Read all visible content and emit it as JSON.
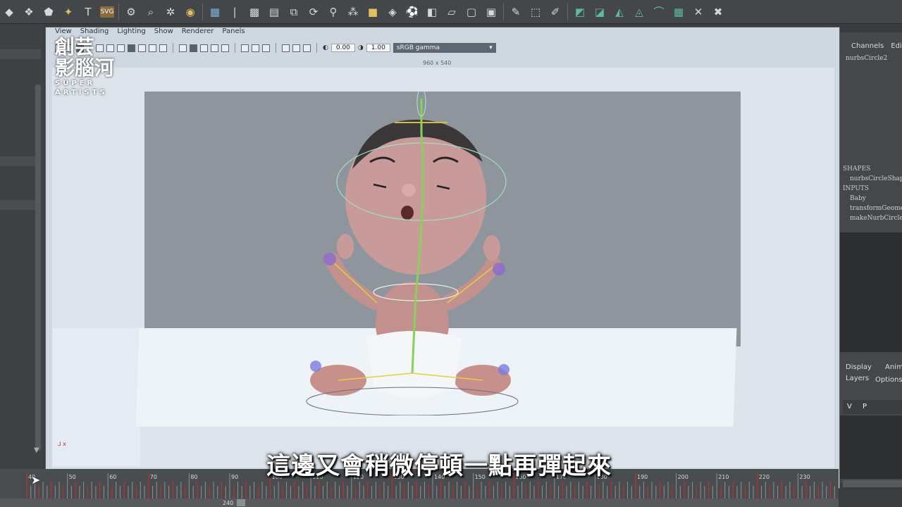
{
  "shelf": {
    "icons": [
      "diamond-icon",
      "shapes-icon",
      "polyhedron-icon",
      "sparkle-icon",
      "text-icon",
      "svg-icon",
      "joint-icon",
      "search-pivot-icon",
      "locator-icon",
      "sphere-icon",
      "grid-icon",
      "bend-icon",
      "lattice-icon",
      "cube-grid-icon",
      "transform-box-icon",
      "rotate-box-icon",
      "pin-icon",
      "cluster-icon",
      "cube-icon",
      "deform-icon",
      "soccer-icon",
      "flatten-icon",
      "plane-icon",
      "box-icon",
      "puzzle-icon",
      "pen-icon",
      "select-box-icon",
      "brush-icon",
      "mesh-a-icon",
      "mesh-b-icon",
      "mesh-c-icon",
      "mesh-d-icon",
      "bridge-icon",
      "checker-icon",
      "cross-icon",
      "cancel-icon"
    ],
    "svg_label": "SVG",
    "text_icon_label": "T",
    "counter_label": "0.0"
  },
  "viewport": {
    "menu": [
      "View",
      "Shading",
      "Lighting",
      "Show",
      "Renderer",
      "Panels"
    ],
    "exposure": "0.00",
    "gamma": "1.00",
    "color_space": "sRGB gamma",
    "resolution": "960 x 540"
  },
  "subtitle": "這邊又會稍微停頓一點再彈起來",
  "logo": {
    "cjk_line1": "創芸",
    "cjk_line2": "影腦河",
    "latin_line1": "SUPER",
    "latin_line2": "ARTISTS"
  },
  "channel_box": {
    "tabs": [
      "Channels",
      "Edit"
    ],
    "node": "nurbsCircle2",
    "shapes_header": "SHAPES",
    "shape_item": "nurbsCircleShape",
    "inputs_header": "INPUTS",
    "inputs": [
      "Baby",
      "transformGeometry",
      "makeNurbCircle"
    ]
  },
  "layers": {
    "tabs": [
      "Display",
      "Anim",
      "Layers",
      "Options"
    ],
    "row_v": "V",
    "row_p": "P"
  },
  "timeline": {
    "ticks": [
      "40",
      "50",
      "60",
      "70",
      "80",
      "90",
      "100",
      "110",
      "120",
      "130",
      "140",
      "150",
      "160",
      "170",
      "180",
      "190",
      "200",
      "210",
      "220",
      "230",
      "240"
    ],
    "range_end": "240"
  },
  "colors": {
    "shelf_bg": "#444749",
    "viewport_bg": "#dde4ec",
    "gate_bg": "#8e959d",
    "timeline_bg": "#4a4d50",
    "key_tick": "#d22a2a"
  }
}
